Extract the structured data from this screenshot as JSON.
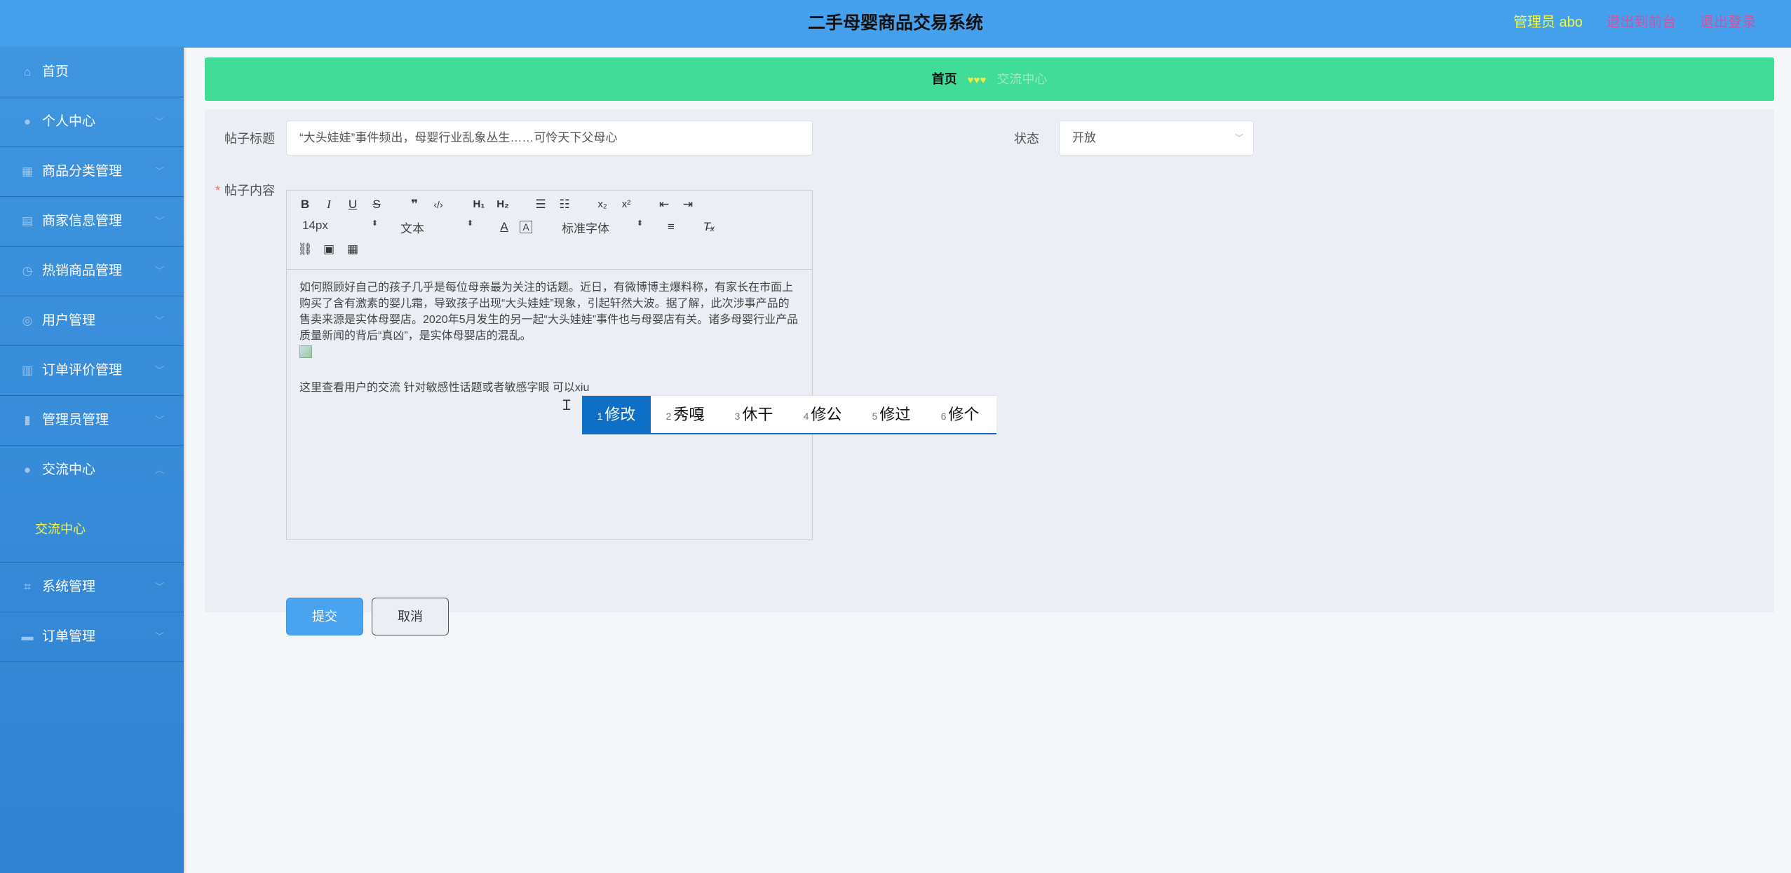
{
  "header": {
    "title": "二手母婴商品交易系统",
    "admin_label": "管理员 abo",
    "to_front": "退出到前台",
    "logout": "退出登录"
  },
  "sidebar": {
    "items": [
      {
        "label": "首页",
        "icon": "home-icon"
      },
      {
        "label": "个人中心",
        "icon": "user-icon"
      },
      {
        "label": "商品分类管理",
        "icon": "grid-icon"
      },
      {
        "label": "商家信息管理",
        "icon": "clipboard-icon"
      },
      {
        "label": "热销商品管理",
        "icon": "clock-icon"
      },
      {
        "label": "用户管理",
        "icon": "compass-icon"
      },
      {
        "label": "订单评价管理",
        "icon": "bar-chart-icon"
      },
      {
        "label": "管理员管理",
        "icon": "document-icon"
      },
      {
        "label": "交流中心",
        "icon": "user-icon"
      },
      {
        "label": "系统管理",
        "icon": "crop-icon"
      },
      {
        "label": "订单管理",
        "icon": "stack-icon"
      }
    ],
    "submenu_active": "交流中心"
  },
  "breadcrumb": {
    "home": "首页",
    "hearts": "♥♥♥",
    "current": "交流中心"
  },
  "form": {
    "title_label": "帖子标题",
    "title_value": "“大头娃娃”事件频出，母婴行业乱象丛生……可怜天下父母心",
    "status_label": "状态",
    "status_value": "开放",
    "content_label": "帖子内容",
    "content_required_mark": "*",
    "toolbar": {
      "font_size": "14px",
      "block_type": "文本",
      "font_family": "标准字体"
    },
    "content_paragraph": "如何照顾好自己的孩子几乎是每位母亲最为关注的话题。近日，有微博博主爆料称，有家长在市面上购买了含有激素的婴儿霜，导致孩子出现“大头娃娃”现象，引起轩然大波。据了解，此次涉事产品的售卖来源是实体母婴店。2020年5月发生的另一起“大头娃娃”事件也与母婴店有关。诸多母婴行业产品质量新闻的背后“真凶”，是实体母婴店的混乱。",
    "content_typing": "这里查看用户的交流  针对敏感性话题或者敏感字眼  可以xiu",
    "submit": "提交",
    "cancel": "取消"
  },
  "ime": {
    "candidates": [
      {
        "num": "1",
        "text": "修改"
      },
      {
        "num": "2",
        "text": "秀嘎"
      },
      {
        "num": "3",
        "text": "休干"
      },
      {
        "num": "4",
        "text": "修公"
      },
      {
        "num": "5",
        "text": "修过"
      },
      {
        "num": "6",
        "text": "修个"
      }
    ]
  }
}
